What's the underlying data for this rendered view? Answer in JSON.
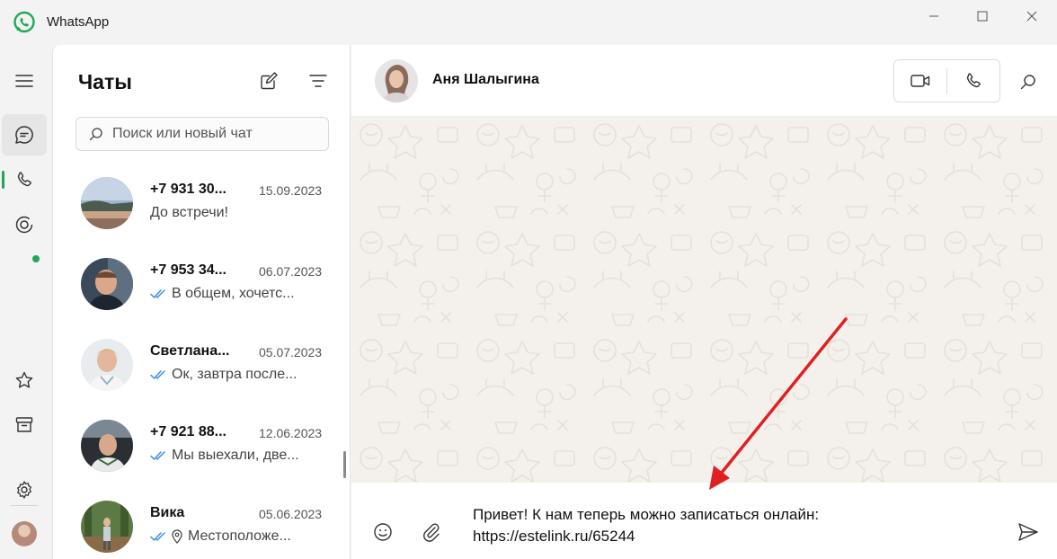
{
  "window": {
    "title": "WhatsApp",
    "accent": "#1fa855"
  },
  "rail": {
    "items": [
      {
        "name": "menu-icon"
      },
      {
        "name": "chats-icon",
        "active": true
      },
      {
        "name": "calls-icon"
      },
      {
        "name": "status-icon"
      },
      {
        "name": "starred-icon"
      },
      {
        "name": "archive-icon"
      },
      {
        "name": "settings-icon"
      }
    ]
  },
  "chatlist": {
    "title": "Чаты",
    "search_placeholder": "Поиск или новый чат",
    "chats": [
      {
        "name": "+7 931 30...",
        "date": "15.09.2023",
        "preview": "До встречи!",
        "ticks": false,
        "location": false
      },
      {
        "name": "+7 953 34...",
        "date": "06.07.2023",
        "preview": "В общем, хочетс...",
        "ticks": true,
        "location": false
      },
      {
        "name": "Светлана...",
        "date": "05.07.2023",
        "preview": "Ок, завтра после...",
        "ticks": true,
        "location": false
      },
      {
        "name": "+7 921 88...",
        "date": "12.06.2023",
        "preview": "Мы выехали, две...",
        "ticks": true,
        "location": false
      },
      {
        "name": "Вика",
        "date": "05.06.2023",
        "preview": "Местоположе...",
        "ticks": true,
        "location": true
      }
    ]
  },
  "conversation": {
    "contact_name": "Аня Шалыгина",
    "draft_line1": "Привет! К нам теперь можно записаться онлайн:",
    "draft_line2": "https://estelink.ru/65244"
  },
  "colors": {
    "tick_blue": "#3d8fe3",
    "annotation_arrow": "#e02020",
    "wallpaper": "#f4f1ec"
  }
}
